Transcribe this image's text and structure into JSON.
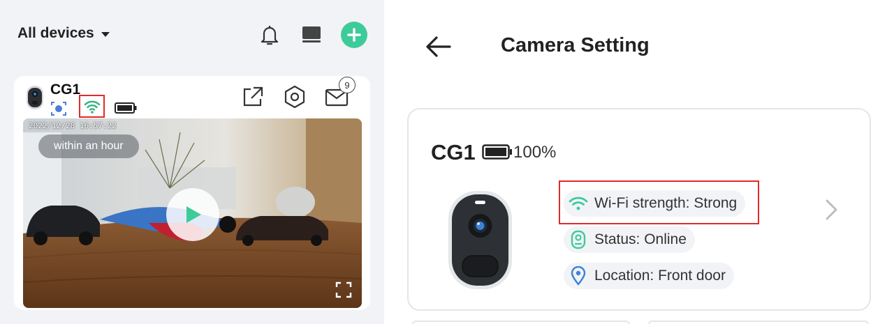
{
  "left": {
    "header": {
      "title": "All devices",
      "icons": [
        "bell-icon",
        "monitor-icon",
        "plus-icon"
      ],
      "accent": "#3ecb9a"
    },
    "device_card": {
      "name": "CG1",
      "notification_count": "9",
      "status_icons": [
        "face-detect-icon",
        "wifi-icon",
        "battery-icon"
      ],
      "action_icons": [
        "share-icon",
        "settings-icon",
        "mail-icon"
      ],
      "video": {
        "timestamp": "2022/12/28 16:57:22",
        "label": "within an hour"
      }
    }
  },
  "right": {
    "title": "Camera Setting",
    "camera": {
      "name": "CG1",
      "battery": "100%",
      "wifi": "Wi-Fi strength: Strong",
      "status": "Status: Online",
      "location": "Location: Front door"
    },
    "colors": {
      "wifi": "#3ecb9a",
      "status": "#3ecb9a",
      "location": "#3c82d8",
      "highlight": "#e02a2a"
    }
  }
}
